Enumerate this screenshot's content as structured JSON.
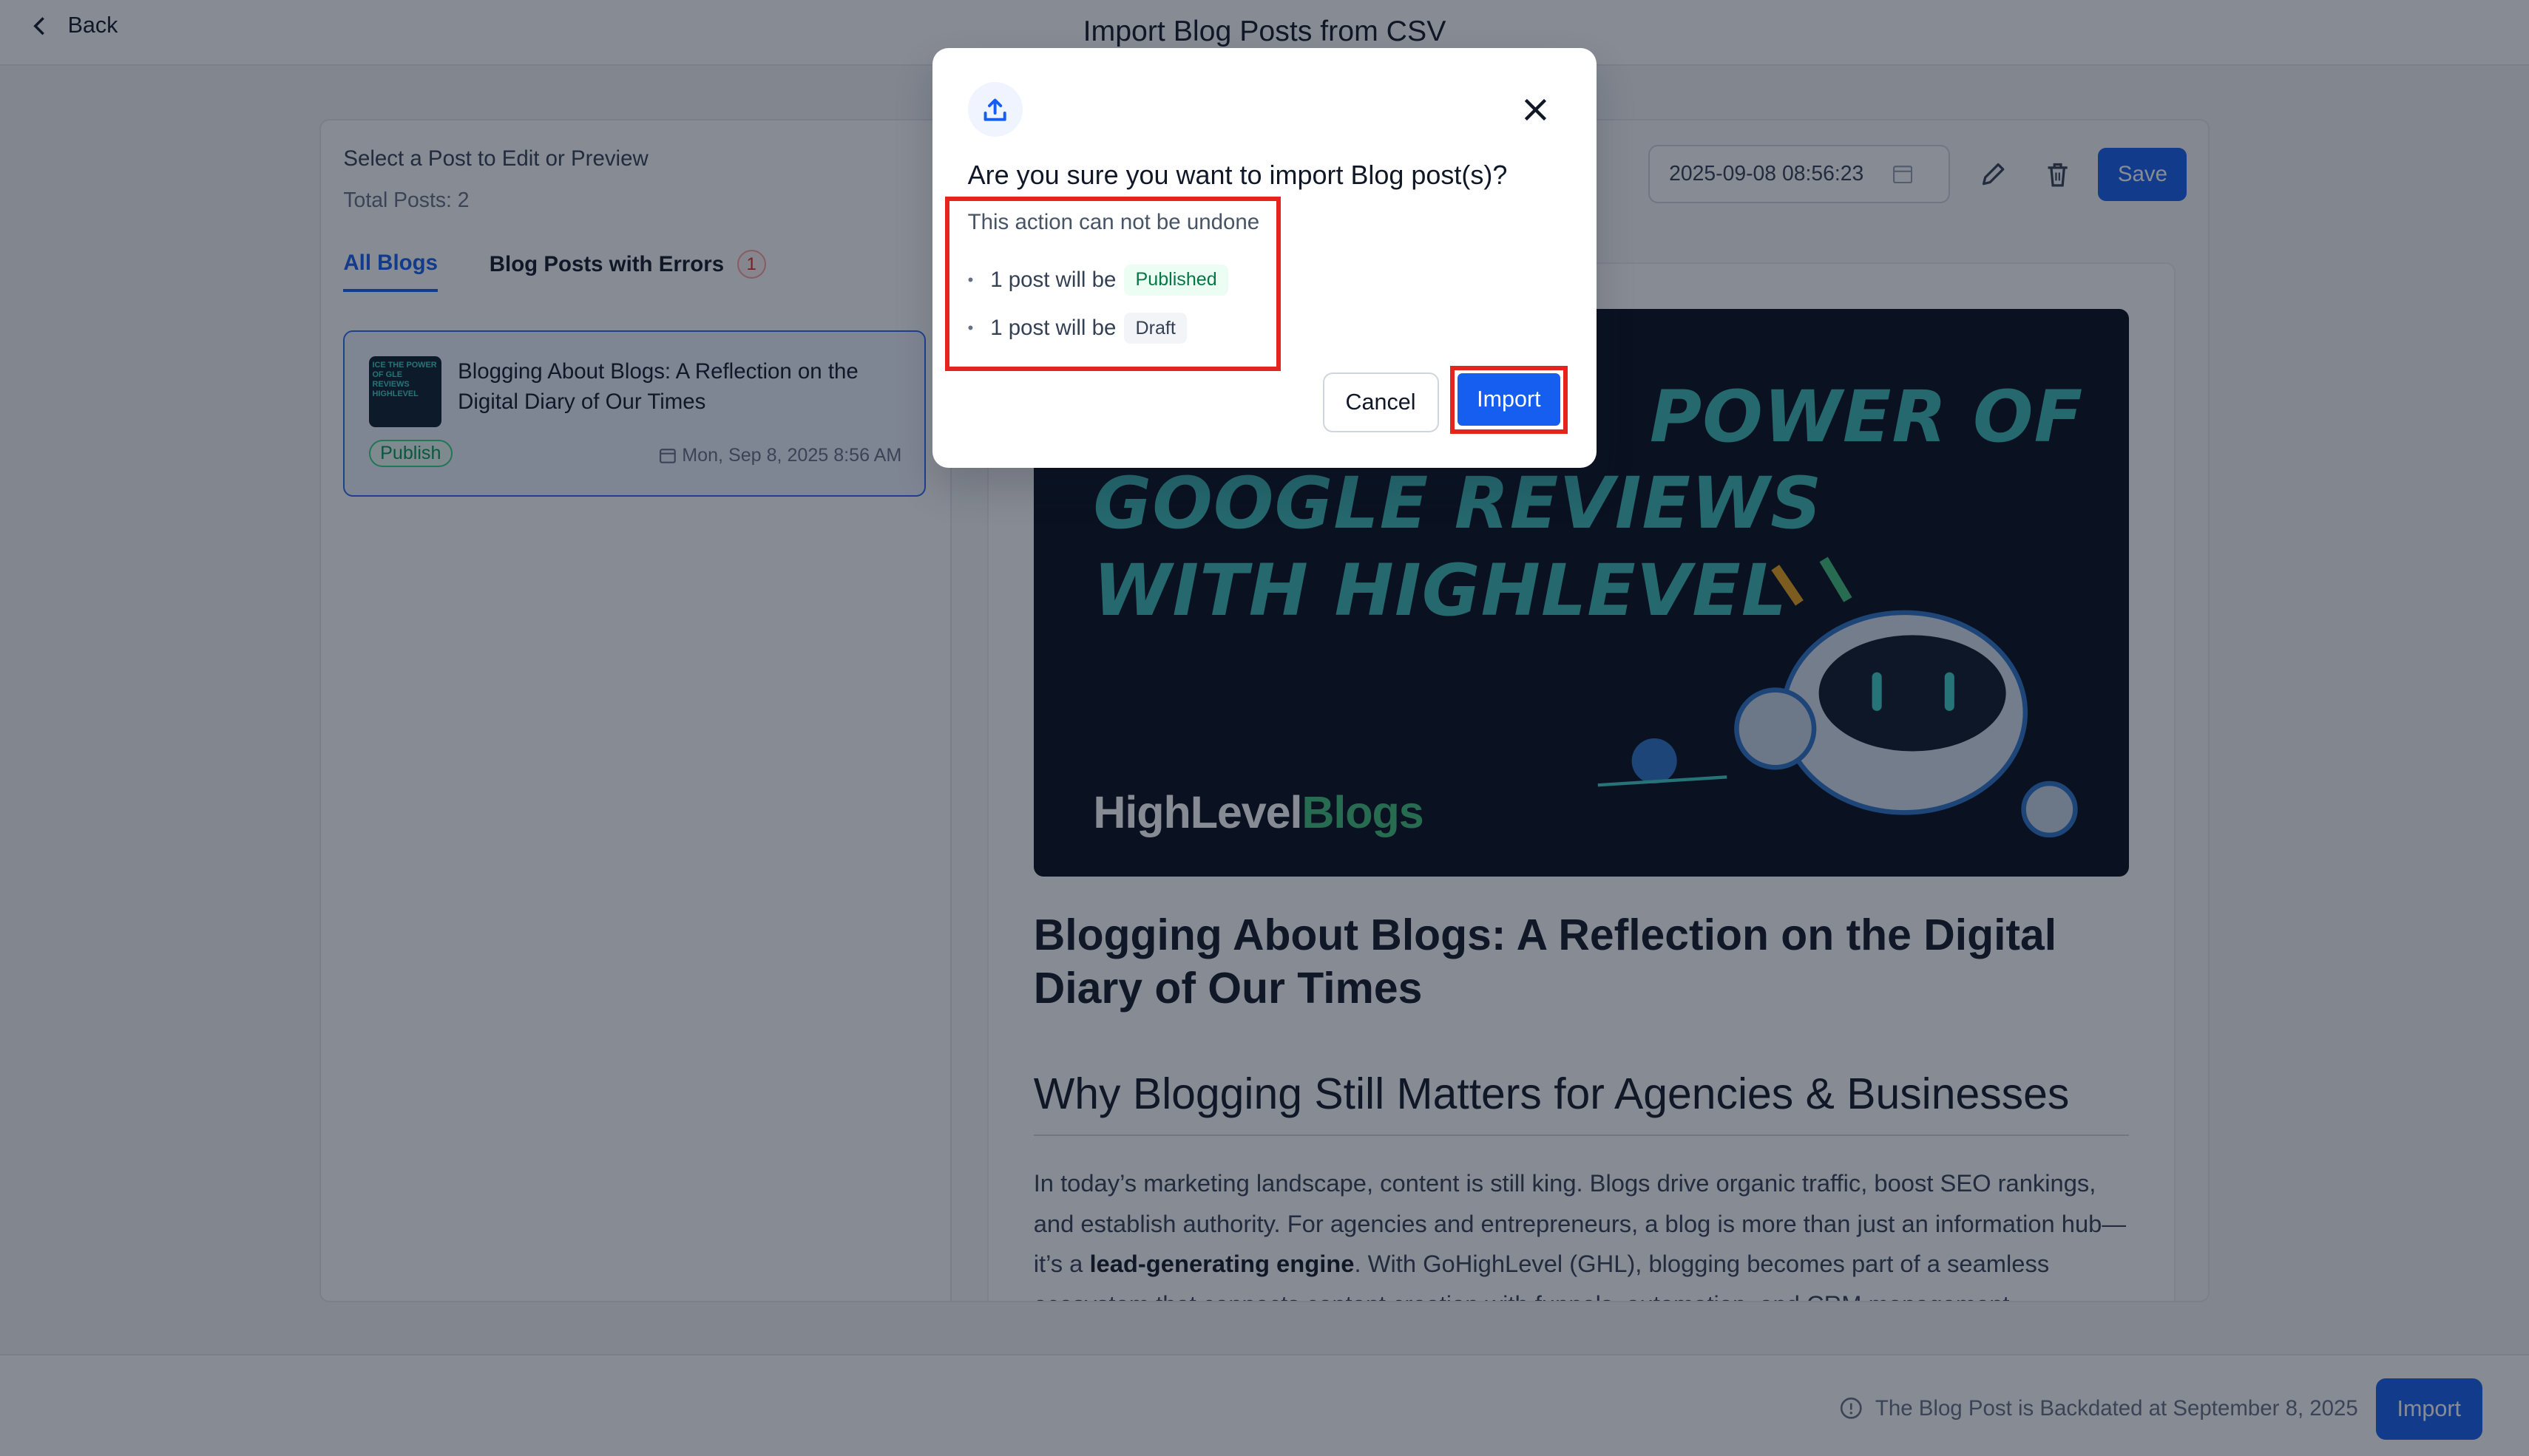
{
  "header": {
    "back_label": "Back",
    "title": "Import Blog Posts from CSV"
  },
  "left_panel": {
    "title": "Select a Post to Edit or Preview",
    "total": "Total Posts: 2",
    "tabs": [
      {
        "label": "All Blogs"
      },
      {
        "label": "Blog Posts with Errors",
        "count": "1"
      }
    ],
    "post": {
      "title": "Blogging About Blogs: A Reflection on the Digital Diary of Our Times",
      "status": "Publish",
      "date": "Mon, Sep 8, 2025 8:56 AM",
      "thumb_text": "ICE THE POWER OF GLE REVIEWS HIGHLEVEL"
    }
  },
  "editor": {
    "date_value": "2025-09-08 08:56:23",
    "save_label": "Save",
    "hero": {
      "line1": "POWER OF",
      "line2": "GOOGLE REVIEWS",
      "line3": "WITH HIGHLEVEL",
      "brand_a": "HighLevel",
      "brand_b": "Blogs"
    },
    "h1": "Blogging About Blogs: A Reflection on the Digital Diary of Our Times",
    "h2": "Why Blogging Still Matters for Agencies & Businesses",
    "p_start": "In today’s marketing landscape, content is still king. Blogs drive organic traffic, boost SEO rankings, and establish authority. For agencies and entrepreneurs, a blog is more than just an information hub—it’s a ",
    "p_bold": "lead-generating engine",
    "p_end": ". With GoHighLevel (GHL), blogging becomes part of a seamless ecosystem that connects content creation with funnels, automation, and CRM management."
  },
  "footer": {
    "note": "The Blog Post is Backdated at September 8, 2025",
    "import_label": "Import"
  },
  "modal": {
    "title": "Are you sure you want to import Blog post(s)?",
    "warning": "This action can not be undone",
    "items": [
      {
        "text": "1 post will be",
        "badge": "Published"
      },
      {
        "text": "1 post will be",
        "badge": "Draft"
      }
    ],
    "cancel_label": "Cancel",
    "import_label": "Import"
  },
  "colors": {
    "primary": "#155eef",
    "highlight": "#e5251d",
    "success": "#067647"
  },
  "icons": [
    "chevron-left-icon",
    "upload-icon",
    "close-icon",
    "calendar-icon",
    "pencil-icon",
    "trash-icon",
    "info-icon"
  ]
}
